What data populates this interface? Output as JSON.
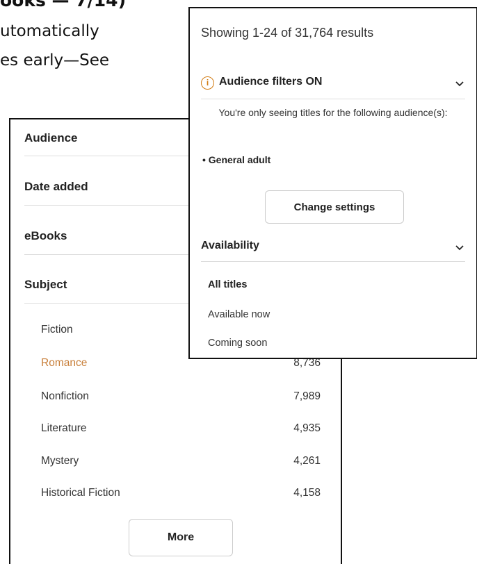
{
  "background_text": {
    "line1": "ooks — 7/14)",
    "line2": "utomatically",
    "line3": "es early—See"
  },
  "left_panel": {
    "facets": [
      "Audience",
      "Date added",
      "eBooks",
      "Subject"
    ],
    "subjects": [
      {
        "label": "Fiction",
        "count": ""
      },
      {
        "label": "Romance",
        "count": "8,736"
      },
      {
        "label": "Nonfiction",
        "count": "7,989"
      },
      {
        "label": "Literature",
        "count": "4,935"
      },
      {
        "label": "Mystery",
        "count": "4,261"
      },
      {
        "label": "Historical Fiction",
        "count": "4,158"
      }
    ],
    "more_label": "More",
    "active_color": "#c87f3a"
  },
  "right_panel": {
    "results_text": "Showing 1-24 of 31,764 results",
    "audience_title": "Audience filters ON",
    "audience_message": "You're only seeing titles for the following audience(s):",
    "audience_item": "General adult",
    "change_settings_label": "Change settings",
    "availability_title": "Availability",
    "availability_options": [
      "All titles",
      "Available now",
      "Coming soon"
    ],
    "selected_option": "All titles",
    "info_icon": "info-icon",
    "accent_color": "#d17b12"
  }
}
